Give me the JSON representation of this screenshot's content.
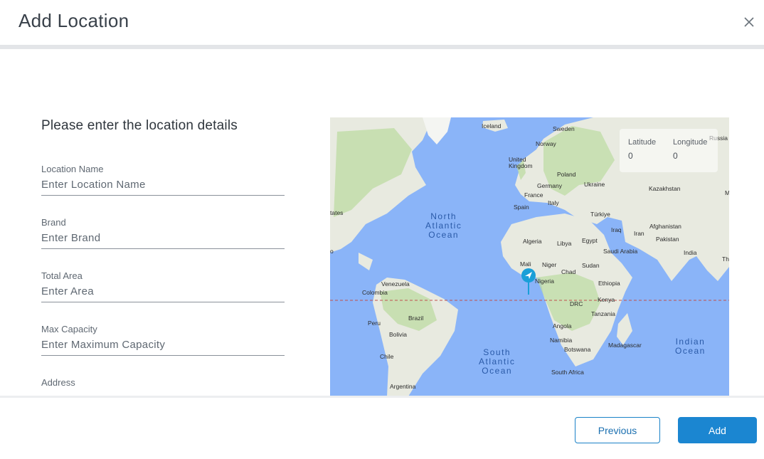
{
  "dialog": {
    "title": "Add Location"
  },
  "form": {
    "heading": "Please enter the location details",
    "fields": [
      {
        "label": "Location Name",
        "placeholder": "Enter Location Name",
        "value": ""
      },
      {
        "label": "Brand",
        "placeholder": "Enter Brand",
        "value": ""
      },
      {
        "label": "Total Area",
        "placeholder": "Enter Area",
        "value": ""
      },
      {
        "label": "Max Capacity",
        "placeholder": "Enter Maximum Capacity",
        "value": ""
      }
    ],
    "address_label": "Address"
  },
  "map": {
    "latitude_label": "Latitude",
    "longitude_label": "Longitude",
    "latitude": "0",
    "longitude": "0",
    "oceans": [
      "North\nAtlantic\nOcean",
      "South\nAtlantic\nOcean",
      "Indian\nOcean"
    ],
    "places": [
      "Iceland",
      "Sweden",
      "Norway",
      "United\nKingdom",
      "Poland",
      "Germany",
      "Ukraine",
      "Kazakhstan",
      "France",
      "Italy",
      "Spain",
      "Türkiye",
      "Afghanistan",
      "Iraq",
      "Iran",
      "Pakistan",
      "Algeria",
      "Libya",
      "Egypt",
      "Saudi Arabia",
      "India",
      "Mali",
      "Niger",
      "Chad",
      "Sudan",
      "Nigeria",
      "Ethiopia",
      "Venezuela",
      "Colombia",
      "Kenya",
      "DRC",
      "Tanzania",
      "Peru",
      "Brazil",
      "Bolivia",
      "Angola",
      "Namibia",
      "Botswana",
      "Madagascar",
      "Chile",
      "South Africa",
      "Argentina",
      "Russia",
      "tates",
      "M",
      "Th",
      "o"
    ],
    "colors": {
      "water": "#8ab4f8",
      "land": "#e8eae0",
      "forest": "#bfdca6",
      "equator": "#c0504d",
      "pin": "#1a9fd8"
    },
    "pin_icon": "navigation-arrow-icon"
  },
  "footer": {
    "previous_label": "Previous",
    "add_label": "Add"
  }
}
